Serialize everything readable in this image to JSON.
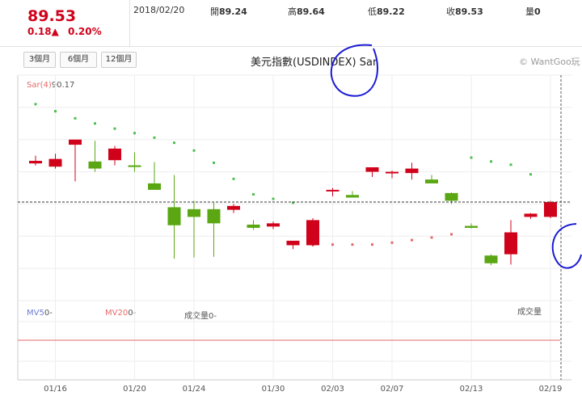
{
  "quote": {
    "price": "89.53",
    "change": "0.18▲",
    "change_pct": "0.20%",
    "date": "2018/02/20",
    "open_label": "開",
    "open": "89.24",
    "high_label": "高",
    "high": "89.64",
    "low_label": "低",
    "low": "89.22",
    "close_label": "收",
    "close": "89.53",
    "volume_label": "量",
    "volume": "0"
  },
  "tabs": [
    "3個月",
    "6個月",
    "12個月"
  ],
  "chart_title": "美元指數(USDINDEX) Sar",
  "brand": "© WantGoo玩",
  "indicator": {
    "label": "Sar(4)",
    "value": "90.17"
  },
  "volume_panel": {
    "mv5_label": "MV5",
    "mv5_value": "0-",
    "mv20_label": "MV20",
    "mv20_value": "0-",
    "vol_label": "成交量",
    "vol_value": "0-",
    "vol_title": "成交量"
  },
  "colors": {
    "up": "#d0021b",
    "down": "#5aa713",
    "sar": "#4ec04e",
    "ma5": "#6b7bd8",
    "ma20": "#e56a6a",
    "annotation": "#1c1cd4"
  },
  "chart_data": {
    "type": "candlestick",
    "x_tick_labels": [
      "01/16",
      "01/20",
      "01/24",
      "01/30",
      "02/03",
      "02/07",
      "02/13",
      "02/19"
    ],
    "x_tick_index": [
      1,
      5,
      8,
      12,
      15,
      18,
      22,
      26
    ],
    "y_range": [
      88.0,
      91.5
    ],
    "candles": [
      {
        "o": 90.13,
        "h": 90.25,
        "l": 90.1,
        "c": 90.17
      },
      {
        "o": 90.08,
        "h": 90.28,
        "l": 90.05,
        "c": 90.2
      },
      {
        "o": 90.42,
        "h": 90.5,
        "l": 89.85,
        "c": 90.5
      },
      {
        "o": 90.16,
        "h": 90.48,
        "l": 90.0,
        "c": 90.05
      },
      {
        "o": 90.18,
        "h": 90.4,
        "l": 90.1,
        "c": 90.36
      },
      {
        "o": 90.1,
        "h": 90.3,
        "l": 90.0,
        "c": 90.08
      },
      {
        "o": 89.82,
        "h": 90.15,
        "l": 89.78,
        "c": 89.72
      },
      {
        "o": 89.45,
        "h": 89.95,
        "l": 88.65,
        "c": 89.17
      },
      {
        "o": 89.42,
        "h": 89.55,
        "l": 88.67,
        "c": 89.3
      },
      {
        "o": 89.42,
        "h": 89.52,
        "l": 88.68,
        "c": 89.2
      },
      {
        "o": 89.41,
        "h": 89.5,
        "l": 89.36,
        "c": 89.47
      },
      {
        "o": 89.18,
        "h": 89.25,
        "l": 89.1,
        "c": 89.13
      },
      {
        "o": 89.15,
        "h": 89.23,
        "l": 89.11,
        "c": 89.2
      },
      {
        "o": 88.86,
        "h": 88.9,
        "l": 88.8,
        "c": 88.93
      },
      {
        "o": 88.86,
        "h": 89.28,
        "l": 88.84,
        "c": 89.25
      },
      {
        "o": 89.7,
        "h": 89.75,
        "l": 89.62,
        "c": 89.72
      },
      {
        "o": 89.64,
        "h": 89.7,
        "l": 89.63,
        "c": 89.6
      },
      {
        "o": 90.0,
        "h": 90.07,
        "l": 89.92,
        "c": 90.07
      },
      {
        "o": 89.98,
        "h": 90.02,
        "l": 89.9,
        "c": 90.0
      },
      {
        "o": 89.98,
        "h": 90.14,
        "l": 89.88,
        "c": 90.05
      },
      {
        "o": 89.88,
        "h": 89.95,
        "l": 89.84,
        "c": 89.82
      },
      {
        "o": 89.67,
        "h": 89.68,
        "l": 89.5,
        "c": 89.55
      },
      {
        "o": 89.16,
        "h": 89.2,
        "l": 89.12,
        "c": 89.13
      },
      {
        "o": 88.7,
        "h": 88.72,
        "l": 88.55,
        "c": 88.58
      },
      {
        "o": 88.72,
        "h": 89.25,
        "l": 88.56,
        "c": 89.06
      },
      {
        "o": 89.3,
        "h": 89.36,
        "l": 89.27,
        "c": 89.35
      },
      {
        "o": 89.3,
        "h": 89.55,
        "l": 89.28,
        "c": 89.53
      }
    ],
    "sar": [
      {
        "i": 0,
        "v": 91.05
      },
      {
        "i": 1,
        "v": 90.94
      },
      {
        "i": 2,
        "v": 90.83
      },
      {
        "i": 3,
        "v": 90.75
      },
      {
        "i": 4,
        "v": 90.67
      },
      {
        "i": 5,
        "v": 90.6
      },
      {
        "i": 6,
        "v": 90.53
      },
      {
        "i": 7,
        "v": 90.45
      },
      {
        "i": 8,
        "v": 90.33
      },
      {
        "i": 9,
        "v": 90.14
      },
      {
        "i": 10,
        "v": 89.89
      },
      {
        "i": 11,
        "v": 89.65
      },
      {
        "i": 12,
        "v": 89.58
      },
      {
        "i": 13,
        "v": 89.52
      },
      {
        "i": 14,
        "v": 88.87
      },
      {
        "i": 15,
        "v": 88.87
      },
      {
        "i": 16,
        "v": 88.87
      },
      {
        "i": 17,
        "v": 88.87
      },
      {
        "i": 18,
        "v": 88.9
      },
      {
        "i": 19,
        "v": 88.94
      },
      {
        "i": 20,
        "v": 88.98
      },
      {
        "i": 21,
        "v": 89.03
      },
      {
        "i": 22,
        "v": 90.22
      },
      {
        "i": 23,
        "v": 90.16
      },
      {
        "i": 24,
        "v": 90.11
      },
      {
        "i": 25,
        "v": 89.96
      },
      {
        "i": 26,
        "v": 89.45
      }
    ],
    "sar_colors": {
      "above": "#4ec04e",
      "below": "#e56a6a"
    },
    "last_close": 89.53,
    "grid": true
  }
}
